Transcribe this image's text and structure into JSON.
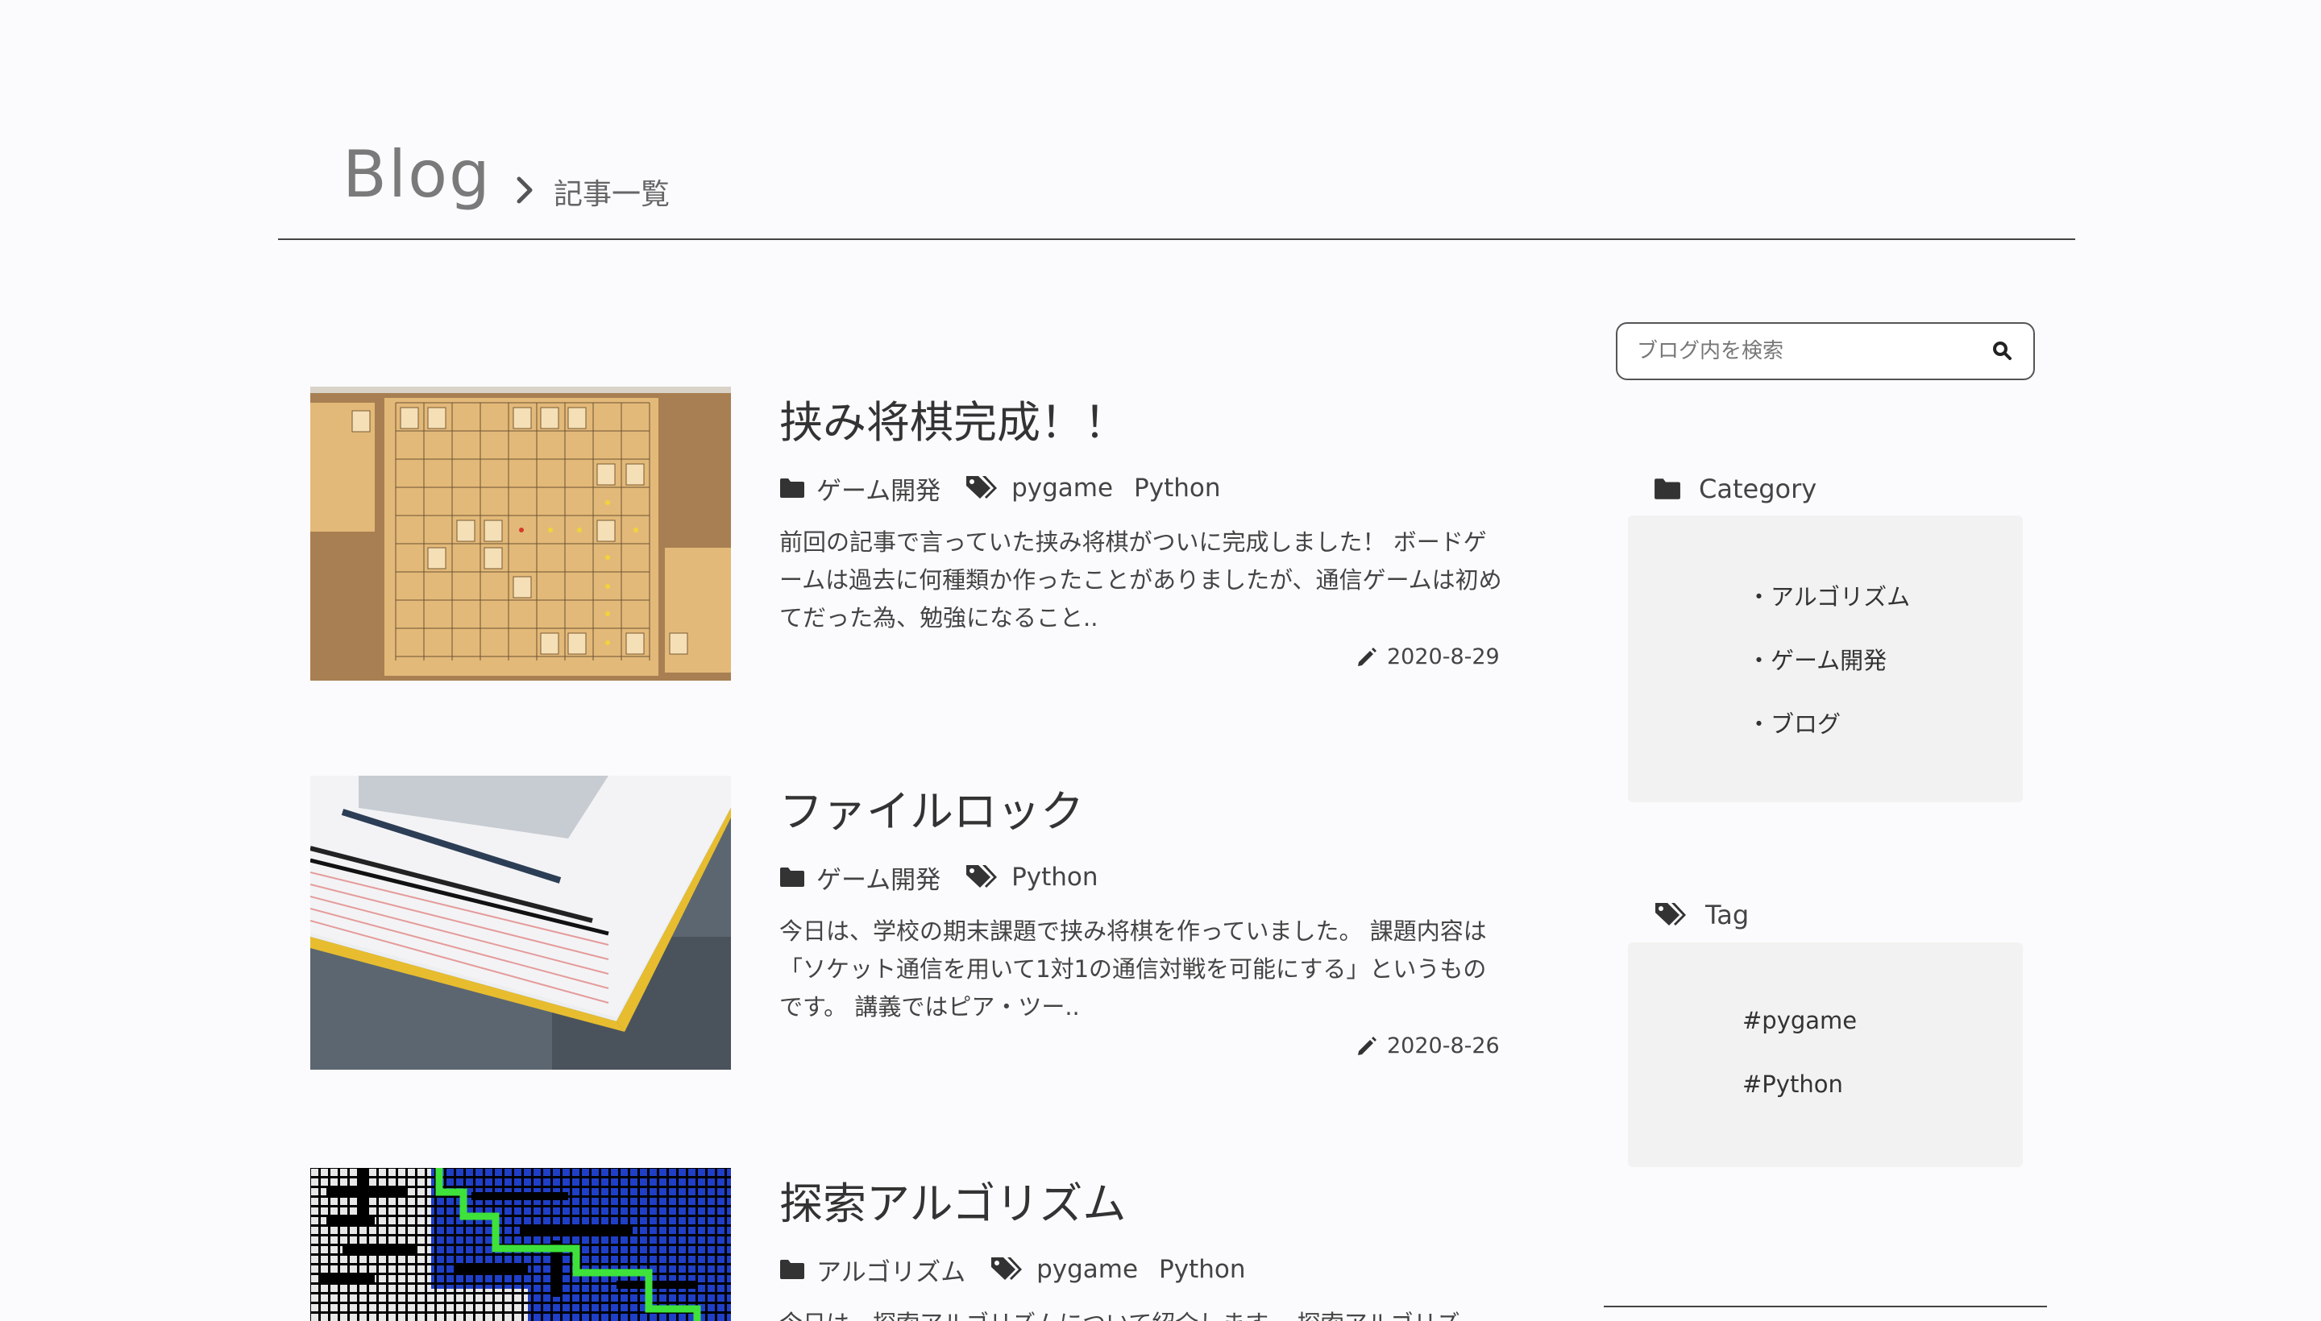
{
  "header": {
    "blog_title": "Blog",
    "breadcrumb": "記事一覧"
  },
  "articles": [
    {
      "title": "挟み将棋完成！！",
      "category": "ゲーム開発",
      "tags": [
        "pygame",
        "Python"
      ],
      "excerpt": "前回の記事で言っていた挟み将棋がついに完成しました！ ボードゲームは過去に何種類か作ったことがありましたが、通信ゲームは初めてだった為、勉強になること..",
      "date": "2020-8-29",
      "thumbnail": "shogi-board-screenshot"
    },
    {
      "title": "ファイルロック",
      "category": "ゲーム開発",
      "tags": [
        "Python"
      ],
      "excerpt": "今日は、学校の期末課題で挟み将棋を作っていました。 課題内容は「ソケット通信を用いて1対1の通信対戦を可能にする」というものです。 講義ではピア・ツー..",
      "date": "2020-8-26",
      "thumbnail": "notebook-photo"
    },
    {
      "title": "探索アルゴリズム",
      "category": "アルゴリズム",
      "tags": [
        "pygame",
        "Python"
      ],
      "excerpt": "今日は、探索アルゴリズムについて紹介します。 探索アルゴリズ",
      "thumbnail": "maze-screenshot"
    }
  ],
  "sidebar": {
    "search_placeholder": "ブログ内を検索",
    "category_heading": "Category",
    "categories": [
      "・アルゴリズム",
      "・ゲーム開発",
      "・ブログ"
    ],
    "tag_heading": "Tag",
    "tags": [
      "#pygame",
      "#Python"
    ]
  },
  "icons": {
    "folder": "folder-icon",
    "tags": "tags-icon",
    "pencil": "pencil-icon",
    "search": "search-icon",
    "chevron": "chevron-right-icon"
  },
  "colors": {
    "background": "#fbfbfd",
    "text": "#333333",
    "widget_bg": "#f2f2f2",
    "muted": "#7a7a7a"
  }
}
